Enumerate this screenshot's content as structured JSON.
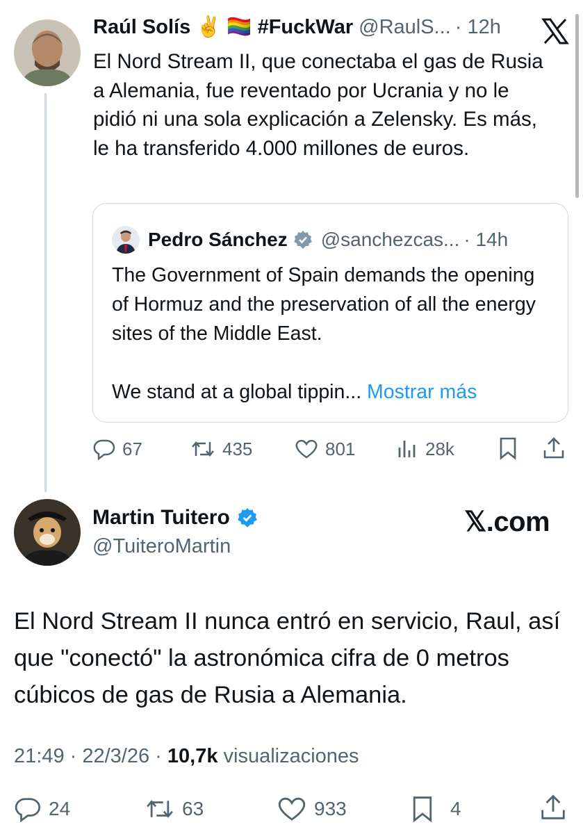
{
  "tweet1": {
    "name": "Raúl Solís ✌️ 🏳️‍🌈 #FuckWar",
    "handle": "@RaulS...",
    "time": "· 12h",
    "body": "El Nord Stream II, que conectaba el gas de Rusia a Alemania, fue reventado por Ucrania y no le pidió ni una sola explicación a Zelensky. Es más, le ha transferido 4.000 millones de euros.",
    "quote": {
      "name": "Pedro Sánchez",
      "handle": "@sanchezcas...",
      "time": "· 14h",
      "body_line1": "The Government of Spain demands the opening of Hormuz and the preservation of all the energy sites of the Middle East.",
      "body_line2": "We stand at a global tippin...",
      "show_more": "Mostrar más"
    },
    "actions": {
      "replies": "67",
      "reposts": "435",
      "likes": "801",
      "views": "28k"
    }
  },
  "tweet2": {
    "name": "Martin Tuitero",
    "handle": "@TuiteroMartin",
    "brand": "𝕏.com",
    "body": "El Nord Stream II nunca entró en servicio, Raul, así que \"conectó\" la astronómica cifra de 0 metros cúbicos de gas de Rusia a Alemania.",
    "meta_time": "21:49 · 22/3/26 · ",
    "meta_views_count": "10,7k",
    "meta_views_label": " visualizaciones",
    "actions": {
      "replies": "24",
      "reposts": "63",
      "likes": "933",
      "bookmarks": "4"
    }
  },
  "colors": {
    "accent": "#1d9bf0",
    "muted": "#536471",
    "border": "#cfd9de"
  }
}
